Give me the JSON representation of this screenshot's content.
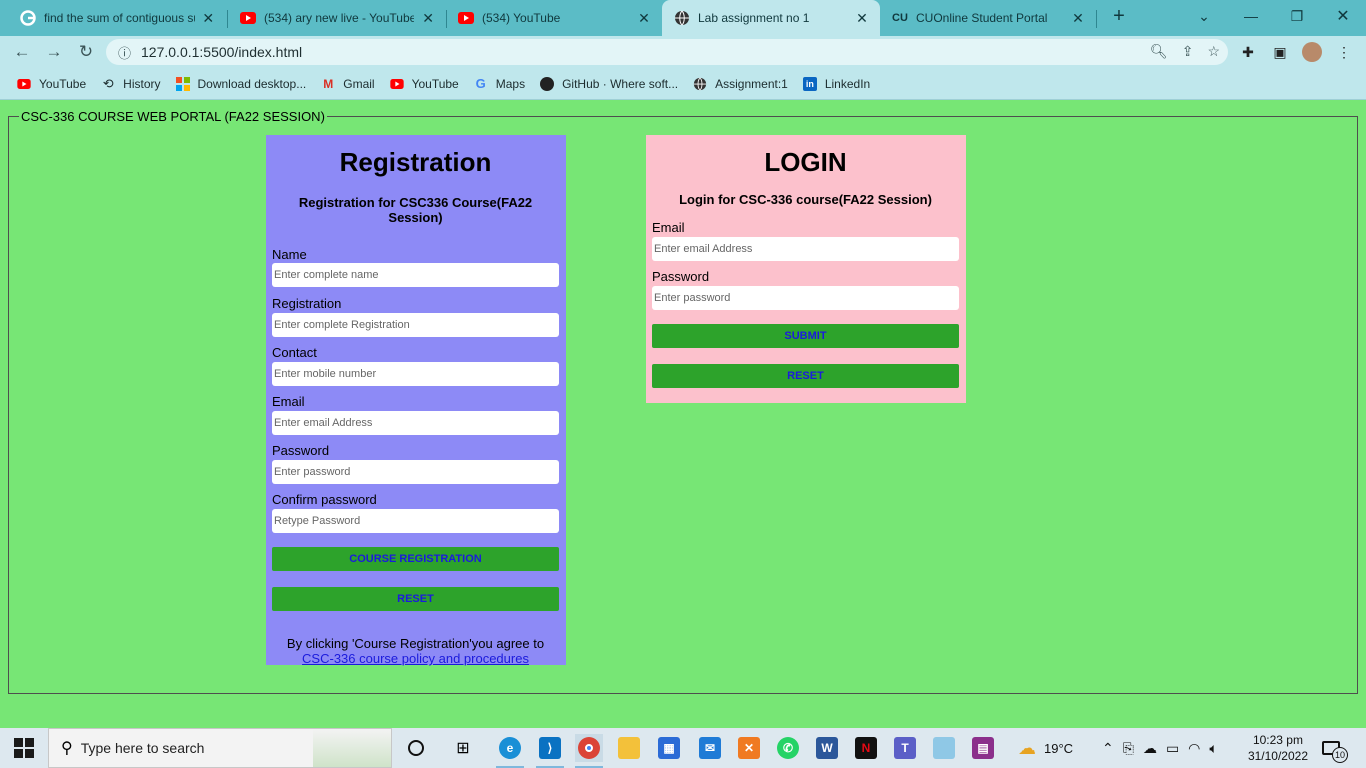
{
  "browser": {
    "tabs": [
      {
        "title": "find the sum of contiguous su",
        "icon": "google-icon",
        "active": false
      },
      {
        "title": "(534) ary new live - YouTube",
        "icon": "youtube-icon",
        "active": false
      },
      {
        "title": "(534) YouTube",
        "icon": "youtube-icon",
        "active": false
      },
      {
        "title": "Lab assignment no 1",
        "icon": "globe-icon",
        "active": true
      },
      {
        "title": "CUOnline Student Portal",
        "icon": "cu-icon",
        "active": false
      }
    ],
    "new_tab_symbol": "+",
    "url": "127.0.0.1:5500/index.html",
    "bookmarks": [
      {
        "label": "YouTube",
        "icon": "youtube-icon"
      },
      {
        "label": "History",
        "icon": "history-icon"
      },
      {
        "label": "Download desktop...",
        "icon": "microsoft-icon"
      },
      {
        "label": "Gmail",
        "icon": "gmail-icon"
      },
      {
        "label": "YouTube",
        "icon": "youtube-icon"
      },
      {
        "label": "Maps",
        "icon": "google-icon"
      },
      {
        "label": "GitHub · Where soft...",
        "icon": "github-icon"
      },
      {
        "label": "Assignment:1",
        "icon": "globe-icon"
      },
      {
        "label": "LinkedIn",
        "icon": "linkedin-icon"
      }
    ]
  },
  "portal": {
    "legend": "CSC-336 COURSE WEB PORTAL (FA22 SESSION)",
    "registration": {
      "heading": "Registration",
      "subheading": "Registration for CSC336 Course(FA22 Session)",
      "fields": [
        {
          "label": "Name",
          "placeholder": "Enter complete name"
        },
        {
          "label": "Registration",
          "placeholder": "Enter complete Registration"
        },
        {
          "label": "Contact",
          "placeholder": "Enter mobile number"
        },
        {
          "label": "Email",
          "placeholder": "Enter email Address"
        },
        {
          "label": "Password",
          "placeholder": "Enter password"
        },
        {
          "label": "Confirm password",
          "placeholder": "Retype Password"
        }
      ],
      "submit_label": "COURSE REGISTRATION",
      "reset_label": "RESET",
      "agree_text": "By clicking 'Course Registration'you agree to",
      "policy_link": "CSC-336 course policy and procedures"
    },
    "login": {
      "heading": "LOGIN",
      "subheading": "Login for CSC-336 course(FA22 Session)",
      "fields": [
        {
          "label": "Email",
          "placeholder": "Enter email Address"
        },
        {
          "label": "Password",
          "placeholder": "Enter password"
        }
      ],
      "submit_label": "SUBMIT",
      "reset_label": "RESET"
    }
  },
  "taskbar": {
    "search_placeholder": "Type here to search",
    "weather": "19°C",
    "time": "10:23 pm",
    "date": "31/10/2022",
    "notifications": "10"
  },
  "colors": {
    "page_bg": "#77e675",
    "registration_bg": "#8d8af6",
    "login_bg": "#fcc1cc",
    "button_bg": "#2da32b",
    "button_text": "#1b1bdc",
    "tab_strip": "#5bbcc6",
    "toolbar": "#bfe7ec"
  }
}
